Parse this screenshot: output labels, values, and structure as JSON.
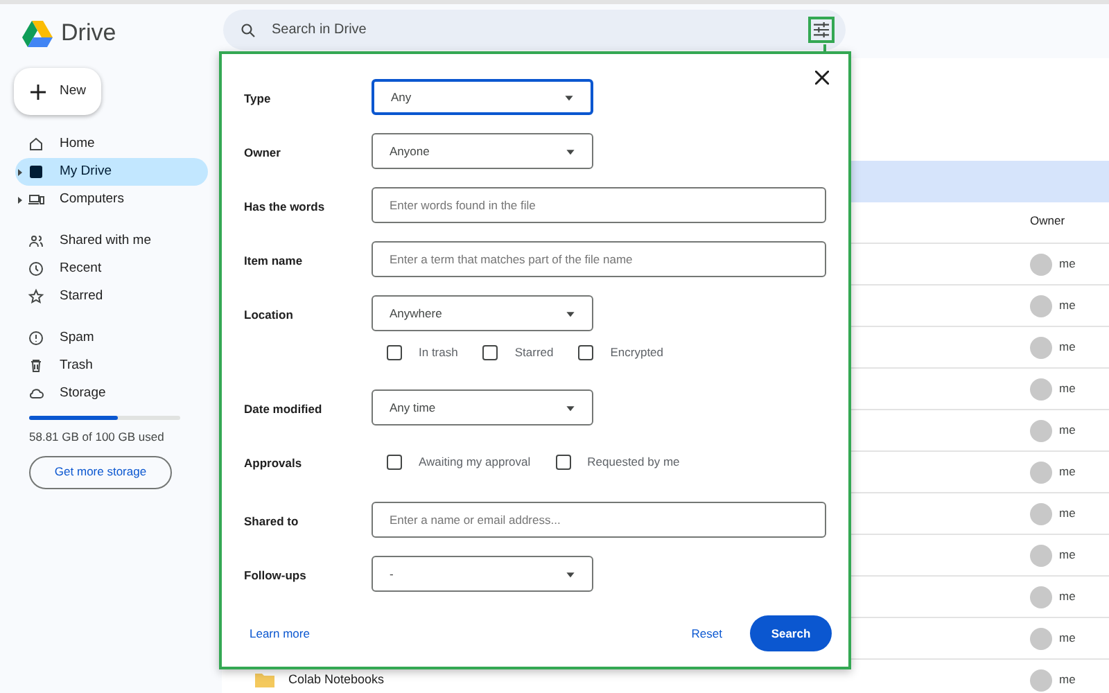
{
  "app": {
    "title": "Drive"
  },
  "new_button": {
    "label": "New"
  },
  "sidebar": {
    "groups": [
      [
        {
          "label": "Home",
          "selected": false,
          "expandable": false
        },
        {
          "label": "My Drive",
          "selected": true,
          "expandable": true
        },
        {
          "label": "Computers",
          "selected": false,
          "expandable": true
        }
      ],
      [
        {
          "label": "Shared with me",
          "selected": false,
          "expandable": false
        },
        {
          "label": "Recent",
          "selected": false,
          "expandable": false
        },
        {
          "label": "Starred",
          "selected": false,
          "expandable": false
        }
      ],
      [
        {
          "label": "Spam",
          "selected": false,
          "expandable": false
        },
        {
          "label": "Trash",
          "selected": false,
          "expandable": false
        },
        {
          "label": "Storage",
          "selected": false,
          "expandable": false
        }
      ]
    ],
    "storage": {
      "level": 0.59,
      "text": "58.81 GB of 100 GB used",
      "button": "Get more storage"
    }
  },
  "search": {
    "placeholder": "Search in Drive"
  },
  "file_list": {
    "columns": [
      "Owner"
    ],
    "rows": [
      {
        "owner": "me"
      },
      {
        "owner": "me"
      },
      {
        "owner": "me"
      },
      {
        "owner": "me"
      },
      {
        "owner": "me"
      },
      {
        "owner": "me"
      },
      {
        "owner": "me"
      },
      {
        "owner": "me"
      },
      {
        "owner": "me"
      },
      {
        "owner": "me"
      },
      {
        "name": "Colab Notebooks",
        "kind": "folder",
        "owner": "me"
      }
    ]
  },
  "advanced_search": {
    "fields": [
      {
        "kind": "select",
        "label": "Type",
        "value": "Any",
        "focused": true
      },
      {
        "kind": "select",
        "label": "Owner",
        "value": "Anyone",
        "focused": false
      },
      {
        "kind": "text",
        "label": "Has the words",
        "placeholder": "Enter words found in the file"
      },
      {
        "kind": "text",
        "label": "Item name",
        "placeholder": "Enter a term that matches part of the file name"
      },
      {
        "kind": "select",
        "label": "Location",
        "value": "Anywhere",
        "focused": false
      },
      {
        "kind": "checkboxes",
        "options": [
          {
            "label": "In trash",
            "checked": false
          },
          {
            "label": "Starred",
            "checked": false
          },
          {
            "label": "Encrypted",
            "checked": false
          }
        ]
      },
      {
        "kind": "select",
        "label": "Date modified",
        "value": "Any time",
        "focused": false
      },
      {
        "kind": "checkboxes",
        "label": "Approvals",
        "options": [
          {
            "label": "Awaiting my approval",
            "checked": false
          },
          {
            "label": "Requested by me",
            "checked": false
          }
        ]
      },
      {
        "kind": "text",
        "label": "Shared to",
        "placeholder": "Enter a name or email address..."
      },
      {
        "kind": "select",
        "label": "Follow-ups",
        "value": "-",
        "focused": false
      }
    ],
    "learn_more": "Learn more",
    "reset": "Reset",
    "search": "Search"
  }
}
